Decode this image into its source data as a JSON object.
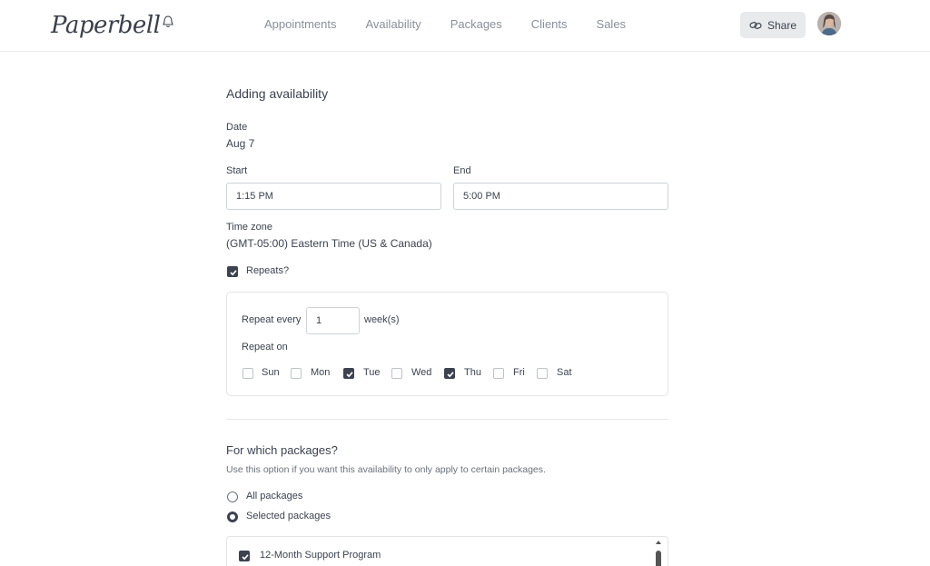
{
  "header": {
    "logo_text": "Paperbell",
    "nav": [
      "Appointments",
      "Availability",
      "Packages",
      "Clients",
      "Sales"
    ],
    "share_label": "Share"
  },
  "form": {
    "title": "Adding availability",
    "date_label": "Date",
    "date_value": "Aug 7",
    "start_label": "Start",
    "start_value": "1:15 PM",
    "end_label": "End",
    "end_value": "5:00 PM",
    "timezone_label": "Time zone",
    "timezone_value": "(GMT-05:00) Eastern Time (US & Canada)",
    "repeats_label": "Repeats?",
    "repeats_checked": true,
    "repeat_every_label": "Repeat every",
    "repeat_every_value": "1",
    "repeat_unit": "week(s)",
    "repeat_on_label": "Repeat on",
    "days": [
      {
        "label": "Sun",
        "checked": false
      },
      {
        "label": "Mon",
        "checked": false
      },
      {
        "label": "Tue",
        "checked": true
      },
      {
        "label": "Wed",
        "checked": false
      },
      {
        "label": "Thu",
        "checked": true
      },
      {
        "label": "Fri",
        "checked": false
      },
      {
        "label": "Sat",
        "checked": false
      }
    ]
  },
  "packages": {
    "title": "For which packages?",
    "help": "Use this option if you want this availability to only apply to certain packages.",
    "all_label": "All packages",
    "selected_label": "Selected packages",
    "selected_option": "Selected packages",
    "items": [
      {
        "label": "12-Month Support Program",
        "checked": true
      }
    ]
  },
  "colors": {
    "text": "#3c4250",
    "muted": "#8a8f99",
    "border": "#cfd2d8",
    "checked": "#3c4250"
  }
}
